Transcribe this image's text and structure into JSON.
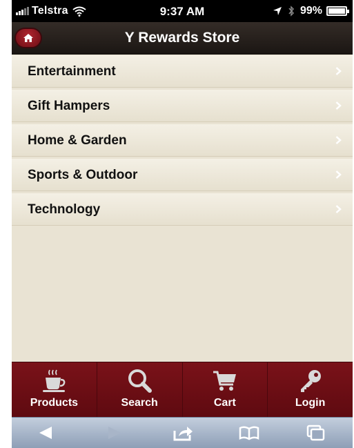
{
  "status_bar": {
    "carrier": "Telstra",
    "time": "9:37 AM",
    "battery": "99%",
    "battery_level": 0.99
  },
  "nav": {
    "title": "Y Rewards Store",
    "home_icon": "home-icon"
  },
  "categories": [
    {
      "label": "Entertainment"
    },
    {
      "label": "Gift Hampers"
    },
    {
      "label": "Home & Garden"
    },
    {
      "label": "Sports & Outdoor"
    },
    {
      "label": "Technology"
    }
  ],
  "tabs": [
    {
      "label": "Products",
      "icon": "coffee-cup-icon"
    },
    {
      "label": "Search",
      "icon": "magnifier-icon"
    },
    {
      "label": "Cart",
      "icon": "cart-icon"
    },
    {
      "label": "Login",
      "icon": "key-icon"
    }
  ],
  "browser_toolbar": {
    "buttons": [
      "back-icon",
      "forward-icon",
      "share-icon",
      "bookmarks-icon",
      "tabs-icon"
    ]
  },
  "colors": {
    "tab_bar": "#6e0e15",
    "nav_bar": "#241d19",
    "list_background": "#e9e3d3",
    "home_button": "#9a1a22"
  }
}
